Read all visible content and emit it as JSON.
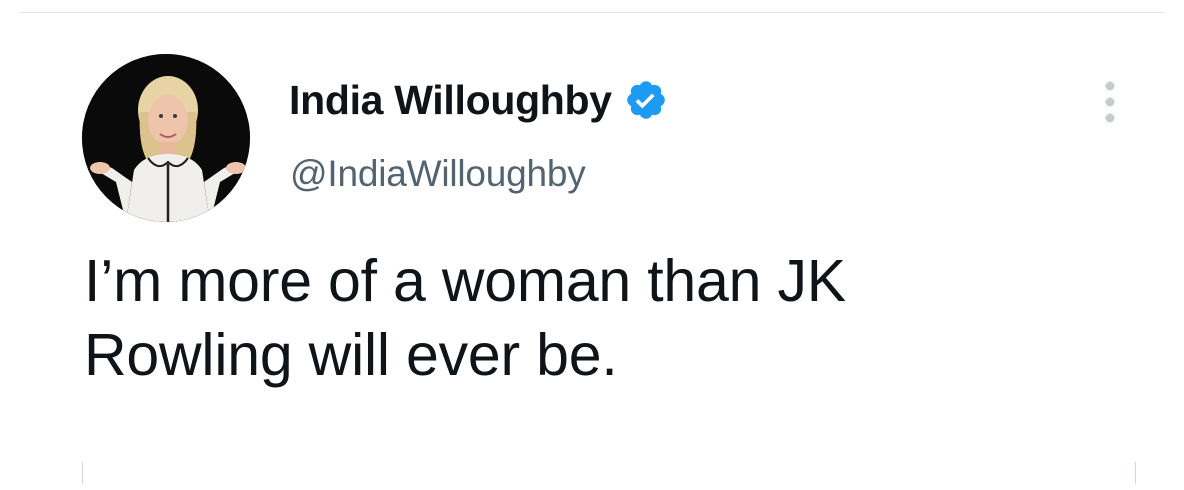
{
  "tweet": {
    "author": {
      "display_name": "India Willoughby",
      "handle": "@IndiaWilloughby",
      "verified": true
    },
    "text_lines": [
      "I’m more of a woman than JK",
      "Rowling will ever be."
    ],
    "icons": {
      "verified": "verified-badge-icon",
      "more": "more-options-icon"
    }
  },
  "colors": {
    "text": "#0f1419",
    "secondary_text": "#536471",
    "verified_blue": "#1d9bf0",
    "divider": "#e6e9eb"
  }
}
